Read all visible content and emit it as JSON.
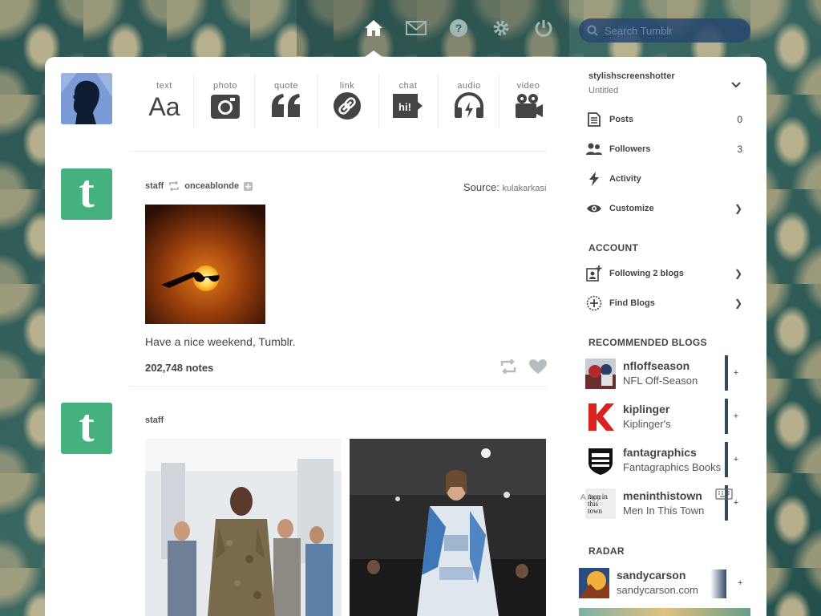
{
  "search": {
    "placeholder": "Search Tumblr"
  },
  "nav": {
    "items": [
      "home-icon",
      "mail-icon",
      "help-icon",
      "settings-icon",
      "power-icon"
    ],
    "active": "home-icon"
  },
  "composer": {
    "types": [
      {
        "label": "text",
        "icon": "text-aa-icon"
      },
      {
        "label": "photo",
        "icon": "camera-icon"
      },
      {
        "label": "quote",
        "icon": "quote-icon"
      },
      {
        "label": "link",
        "icon": "link-icon"
      },
      {
        "label": "chat",
        "icon": "chat-bubble-icon",
        "glyph": "hi!"
      },
      {
        "label": "audio",
        "icon": "headphones-icon"
      },
      {
        "label": "video",
        "icon": "video-camera-icon"
      }
    ]
  },
  "posts": [
    {
      "author": "staff",
      "reblogged_from": "onceablonde",
      "source_label": "Source:",
      "source_name": "kulakarkasi",
      "caption": "Have a nice weekend, Tumblr.",
      "notes": "202,748 notes"
    },
    {
      "author": "staff"
    }
  ],
  "sidebar": {
    "blog_name": "stylishscreenshotter",
    "blog_title": "Untitled",
    "stats": [
      {
        "label": "Posts",
        "count": "0",
        "icon": "document-icon"
      },
      {
        "label": "Followers",
        "count": "3",
        "icon": "people-icon"
      },
      {
        "label": "Activity",
        "icon": "lightning-icon"
      },
      {
        "label": "Customize",
        "icon": "eye-icon"
      }
    ],
    "account_title": "ACCOUNT",
    "account": [
      {
        "label": "Following 2 blogs",
        "icon": "add-person-icon"
      },
      {
        "label": "Find Blogs",
        "icon": "compass-icon"
      }
    ],
    "recommended_title": "RECOMMENDED BLOGS",
    "recommended": [
      {
        "name": "nfloffseason",
        "title": "NFL Off-Season",
        "plus": "+"
      },
      {
        "name": "kiplinger",
        "title": "Kiplinger's",
        "plus": "+"
      },
      {
        "name": "fantagraphics",
        "title": "Fantagraphics Books",
        "plus": "+"
      },
      {
        "name": "meninthistown",
        "title": "Men In This Town",
        "plus": "+",
        "thumb_text": "men in this town"
      }
    ],
    "overlay_text": "A   App",
    "radar_title": "RADAR",
    "radar": {
      "name": "sandycarson",
      "url": "sandycarson.com",
      "plus": "+"
    }
  }
}
